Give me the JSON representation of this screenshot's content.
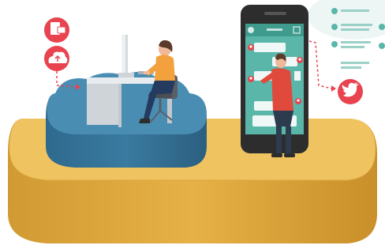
{
  "illustration": {
    "left_icons": [
      "document-icon",
      "cloud-upload-icon"
    ],
    "right_icon": "twitter-bird-icon",
    "phone_avatar_icons": [
      "person-icon",
      "person-icon",
      "person-icon",
      "person-icon"
    ],
    "feed_avatar_icons": [
      "person-icon",
      "person-icon",
      "person-icon",
      "person-icon",
      "person-icon"
    ],
    "colors": {
      "accent_red": "#e8434f",
      "platform_gold": "#e6b146",
      "cloud_blue": "#3a7aa0",
      "phone_black": "#2d2d2d",
      "chat_teal": "#4bb3a3",
      "shirt_orange": "#f2a13c",
      "man_shirt_red": "#e04a3c"
    }
  }
}
